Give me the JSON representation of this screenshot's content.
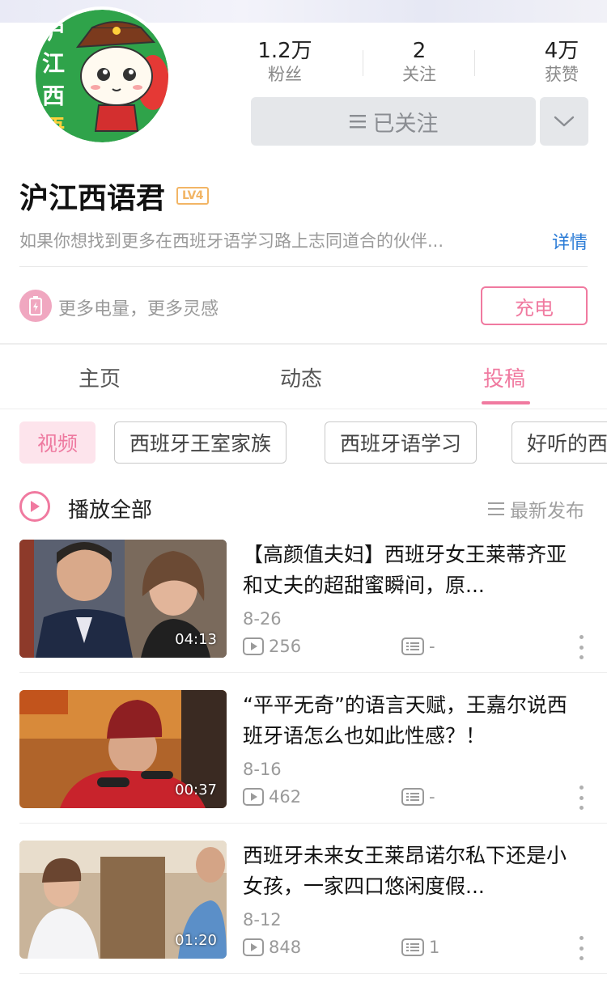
{
  "profile": {
    "name": "沪江西语君",
    "level": "LV4",
    "bio": "如果你想找到更多在西班牙语学习路上志同道合的伙伴...",
    "details_link": "详情",
    "avatar_text": "沪江西语"
  },
  "stats": [
    {
      "value": "1.2万",
      "label": "粉丝"
    },
    {
      "value": "2",
      "label": "关注"
    },
    {
      "value": "4万",
      "label": "获赞"
    }
  ],
  "follow_button": "已关注",
  "charge": {
    "text": "更多电量，更多灵感",
    "button": "充电"
  },
  "tabs": [
    {
      "label": "主页",
      "active": false
    },
    {
      "label": "动态",
      "active": false
    },
    {
      "label": "投稿",
      "active": true
    }
  ],
  "chips": [
    "视频",
    "西班牙王室家族",
    "西班牙语学习",
    "好听的西"
  ],
  "play_all": "播放全部",
  "sort_label": "最新发布",
  "videos": [
    {
      "title": "【高颜值夫妇】西班牙女王莱蒂齐亚和丈夫的超甜蜜瞬间，原...",
      "date": "8-26",
      "plays": "256",
      "comments": "-",
      "duration": "04:13"
    },
    {
      "title": "“平平无奇”的语言天赋，王嘉尔说西班牙语怎么也如此性感？！",
      "date": "8-16",
      "plays": "462",
      "comments": "-",
      "duration": "00:37"
    },
    {
      "title": "西班牙未来女王莱昂诺尔私下还是小女孩，一家四口悠闲度假...",
      "date": "8-12",
      "plays": "848",
      "comments": "1",
      "duration": "01:20"
    }
  ],
  "colors": {
    "accent": "#f07aa0",
    "link": "#2a7bd6",
    "follow_bg": "#e5e7ea"
  }
}
